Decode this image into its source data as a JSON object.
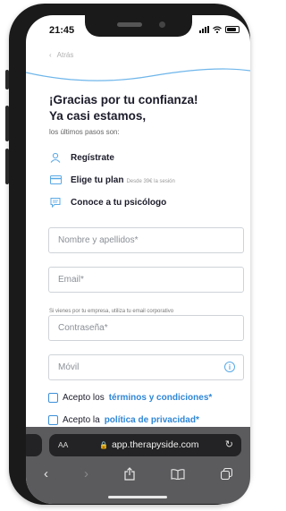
{
  "status": {
    "time": "21:45"
  },
  "header": {
    "back_label": "Atrás"
  },
  "heading": {
    "line1": "¡Gracias por tu confianza!",
    "line2": "Ya casi estamos,"
  },
  "subtitle": "los últimos pasos son:",
  "steps": [
    {
      "label": "Regístrate",
      "icon": "user-icon",
      "note": ""
    },
    {
      "label": "Elige tu plan",
      "icon": "card-icon",
      "note": "Desde 39€ la sesión"
    },
    {
      "label": "Conoce a tu psicólogo",
      "icon": "chat-icon",
      "note": ""
    }
  ],
  "form": {
    "name_placeholder": "Nombre y apellidos*",
    "email_placeholder": "Email*",
    "email_hint": "Si vienes por tu empresa, utiliza tu email corporativo",
    "password_placeholder": "Contraseña*",
    "phone_placeholder": "Móvil",
    "terms_prefix": "Acepto los",
    "terms_link": "términos y condiciones*",
    "privacy_prefix": "Acepto la",
    "privacy_link": "política de privacidad*"
  },
  "browser": {
    "text_size_label": "AA",
    "url": "app.therapyside.com"
  },
  "colors": {
    "accent": "#2f86d6",
    "wave": "#6fb6ea",
    "text": "#1b1b2a"
  }
}
